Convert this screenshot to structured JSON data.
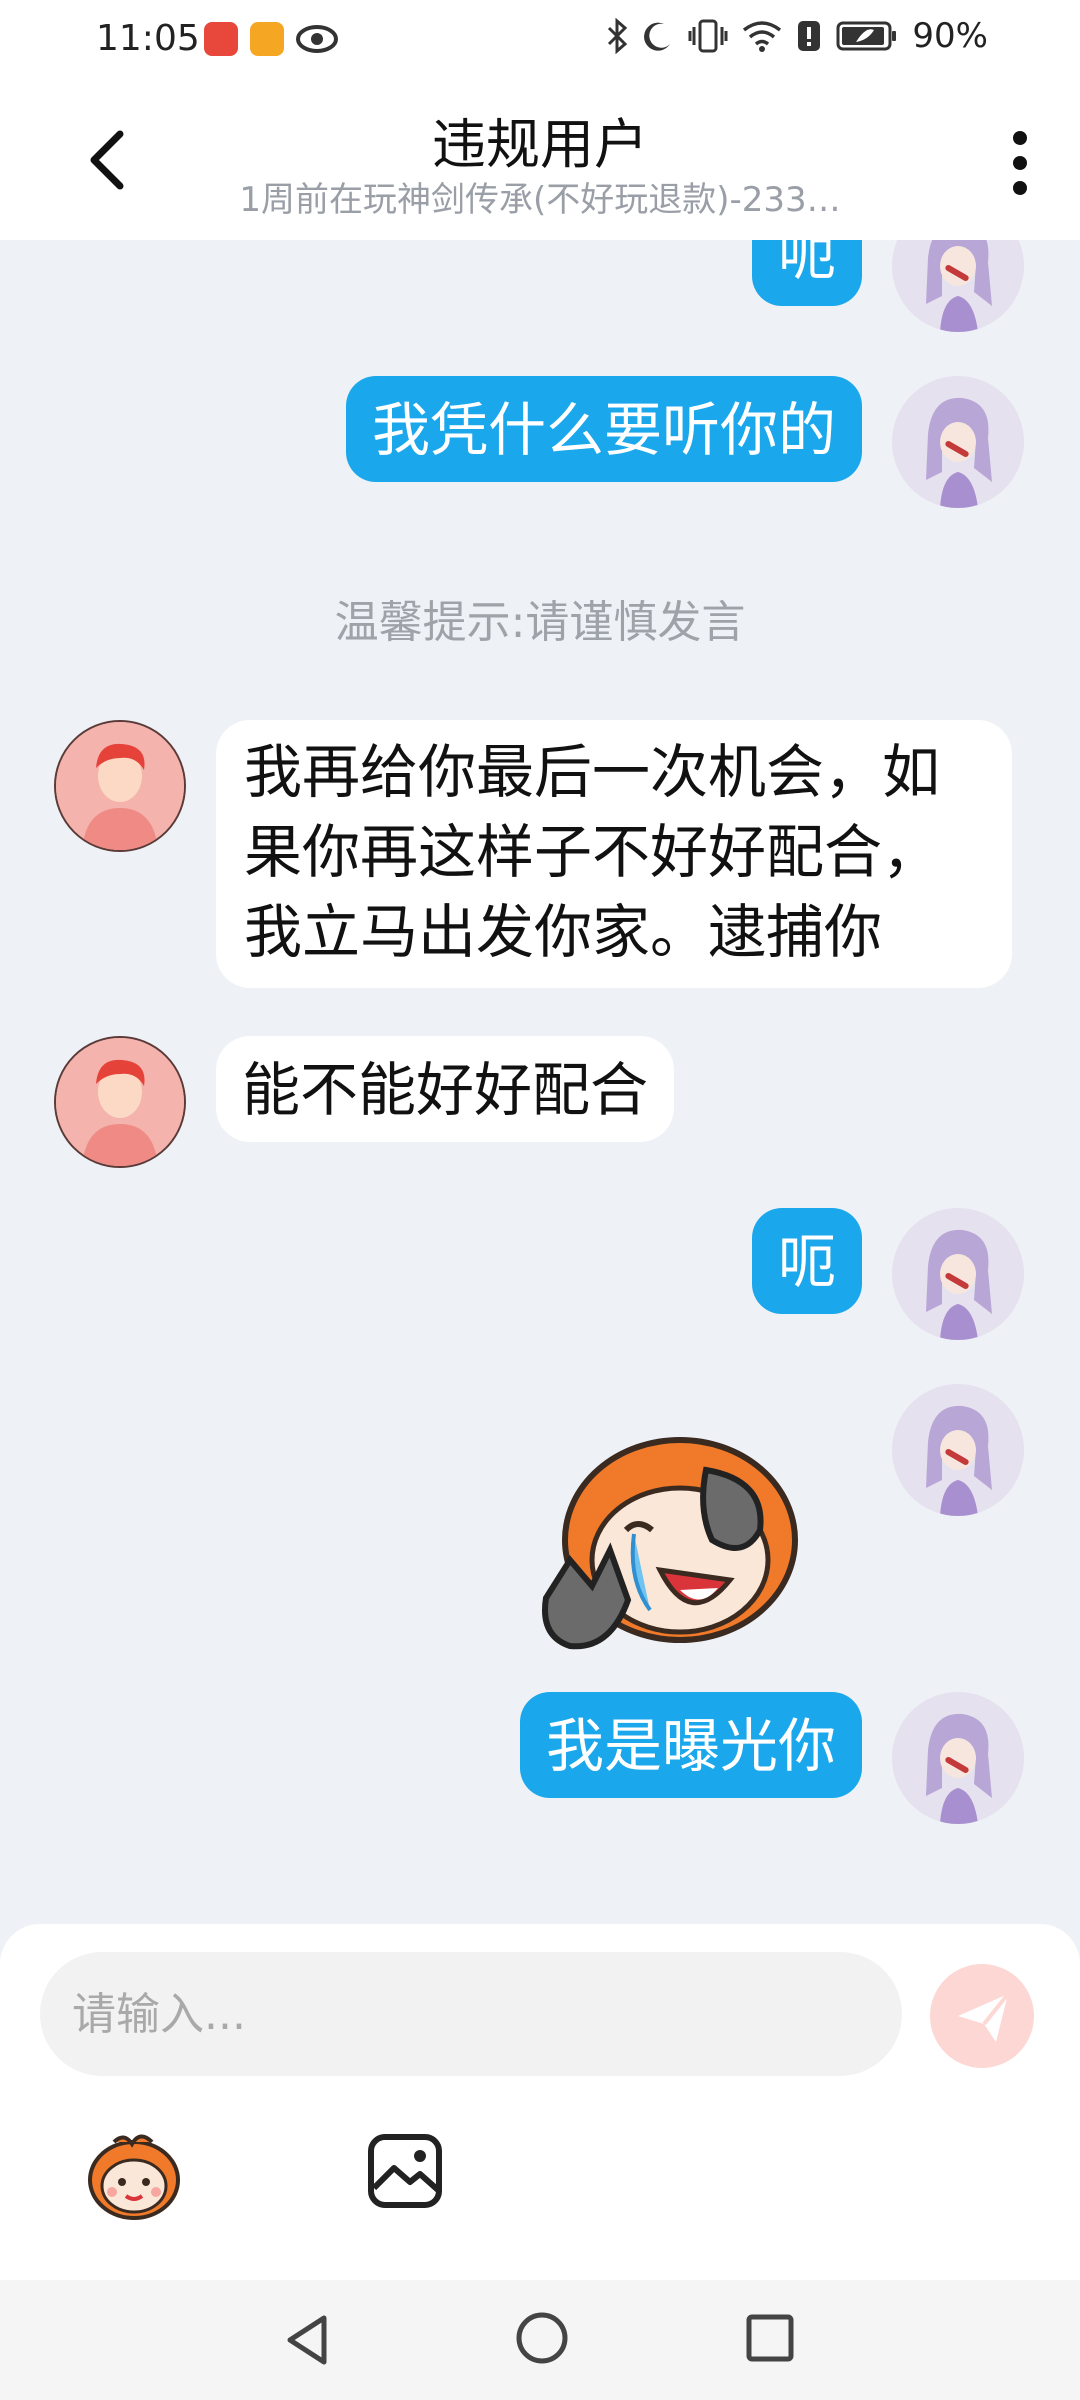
{
  "status_bar": {
    "time": "11:05",
    "battery_percent": "90%",
    "icons": [
      "huawei-app-icon",
      "wallet-app-icon",
      "eye-icon",
      "bluetooth-icon",
      "moon-icon",
      "vibrate-icon",
      "wifi-icon",
      "battery-saver-icon",
      "battery-icon"
    ]
  },
  "header": {
    "title": "违规用户",
    "subtitle": "1周前在玩神剑传承(不好玩退款)-233…"
  },
  "messages": [
    {
      "from": "me",
      "text": "呃"
    },
    {
      "from": "me",
      "text": "我凭什么要听你的"
    },
    {
      "from": "system",
      "text": "温馨提示:请谨慎发言"
    },
    {
      "from": "other",
      "line1": "我再给你最后一次机会，如",
      "line2": "果你再这样子不好好配合，",
      "line3": "我立马出发你家。逮捕你"
    },
    {
      "from": "other",
      "text": "能不能好好配合"
    },
    {
      "from": "me",
      "text": "呃"
    },
    {
      "from": "me",
      "sticker": "crying-laughing-sticker"
    },
    {
      "from": "me",
      "text": "我是曝光你"
    }
  ],
  "input": {
    "placeholder": "请输入..."
  },
  "colors": {
    "my_bubble": "#1aa7ec",
    "other_bubble": "#ffffff",
    "background": "#eef1f6",
    "send_button": "#fcd7d3"
  }
}
